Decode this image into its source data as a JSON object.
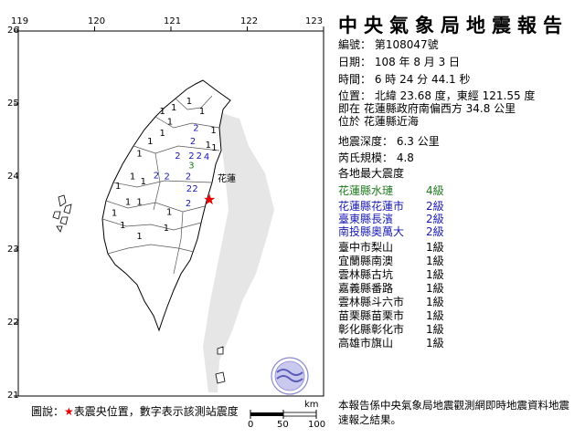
{
  "report": {
    "title": "中央氣象局地震報告",
    "number": "編號： 第108047號",
    "date": "日期： 108 年 8 月 3 日",
    "time": "時間： 6 時 24 分 44.1 秒",
    "position": "位置： 北緯 23.68 度，東經 121.55 度",
    "relative_location": "即在 花蓮縣政府南偏西方 34.8 公里",
    "located_in": "位於 花蓮縣近海",
    "depth": "地震深度： 6.3 公里",
    "magnitude": "芮氏規模： 4.8",
    "intensity_heading": "各地最大震度",
    "intensities": [
      {
        "station": "花蓮縣水璉",
        "level": "4級",
        "color": "#1f7a1f"
      },
      {
        "station": "花蓮縣花蓮市",
        "level": "2級",
        "color": "#1a1ab5"
      },
      {
        "station": "臺東縣長濱",
        "level": "2級",
        "color": "#1a1ab5"
      },
      {
        "station": "南投縣奧萬大",
        "level": "2級",
        "color": "#1a1ab5"
      },
      {
        "station": "臺中市梨山",
        "level": "1級",
        "color": "#000000"
      },
      {
        "station": "宜蘭縣南澳",
        "level": "1級",
        "color": "#000000"
      },
      {
        "station": "雲林縣古坑",
        "level": "1級",
        "color": "#000000"
      },
      {
        "station": "嘉義縣番路",
        "level": "1級",
        "color": "#000000"
      },
      {
        "station": "雲林縣斗六市",
        "level": "1級",
        "color": "#000000"
      },
      {
        "station": "苗栗縣苗栗市",
        "level": "1級",
        "color": "#000000"
      },
      {
        "station": "彰化縣彰化市",
        "level": "1級",
        "color": "#000000"
      },
      {
        "station": "高雄市旗山",
        "level": "1級",
        "color": "#000000"
      }
    ],
    "footnote": "本報告係中央氣象局地震觀測網即時地震資料地震速報之結果。"
  },
  "map": {
    "x_ticks": [
      "119",
      "120",
      "121",
      "122",
      "123"
    ],
    "y_ticks": [
      "26",
      "25",
      "24",
      "23",
      "22",
      "21"
    ],
    "label_hualien": "花蓮",
    "epicenter_color": "#e60000",
    "legend": {
      "prefix": "圖說：",
      "star": "★",
      "suffix": "表震央位置，數字表示該測站震度"
    },
    "scale": {
      "unit": "km",
      "ticks": [
        "0",
        "50",
        "100"
      ]
    },
    "station_markers": [
      {
        "value": "2",
        "color": "#1a1ab5",
        "lon": 121.25,
        "lat": 24.45
      },
      {
        "value": "2",
        "color": "#1a1ab5",
        "lon": 121.05,
        "lat": 24.25
      },
      {
        "value": "2",
        "color": "#1a1ab5",
        "lon": 121.23,
        "lat": 24.25
      },
      {
        "value": "2",
        "color": "#1a1ab5",
        "lon": 121.33,
        "lat": 24.25
      },
      {
        "value": "4",
        "color": "#1a1ab5",
        "lon": 121.43,
        "lat": 24.24
      },
      {
        "value": "3",
        "color": "#1f7a1f",
        "lon": 121.23,
        "lat": 24.12
      },
      {
        "value": "2",
        "color": "#1a1ab5",
        "lon": 120.77,
        "lat": 23.98
      },
      {
        "value": "2",
        "color": "#1a1ab5",
        "lon": 121.19,
        "lat": 23.97
      },
      {
        "value": "2",
        "color": "#1a1ab5",
        "lon": 121.2,
        "lat": 23.8
      },
      {
        "value": "2",
        "color": "#1a1ab5",
        "lon": 121.28,
        "lat": 23.8
      },
      {
        "value": "2",
        "color": "#1a1ab5",
        "lon": 120.91,
        "lat": 23.97
      },
      {
        "value": "2",
        "color": "#1a1ab5",
        "lon": 121.19,
        "lat": 23.6
      },
      {
        "value": "2",
        "color": "#1a1ab5",
        "lon": 121.29,
        "lat": 24.63
      },
      {
        "value": "1",
        "color": "#000000",
        "lon": 121.52,
        "lat": 24.6
      },
      {
        "value": "1",
        "color": "#000000",
        "lon": 121.53,
        "lat": 24.36
      },
      {
        "value": "1",
        "color": "#000000",
        "lon": 121.45,
        "lat": 24.4
      },
      {
        "value": "1",
        "color": "#000000",
        "lon": 120.85,
        "lat": 24.86
      },
      {
        "value": "1",
        "color": "#000000",
        "lon": 121.0,
        "lat": 24.91
      },
      {
        "value": "1",
        "color": "#000000",
        "lon": 121.2,
        "lat": 25.0
      },
      {
        "value": "1",
        "color": "#000000",
        "lon": 121.37,
        "lat": 24.86
      },
      {
        "value": "1",
        "color": "#000000",
        "lon": 120.95,
        "lat": 24.72
      },
      {
        "value": "1",
        "color": "#000000",
        "lon": 120.85,
        "lat": 24.56
      },
      {
        "value": "1",
        "color": "#000000",
        "lon": 120.69,
        "lat": 24.45
      },
      {
        "value": "1",
        "color": "#000000",
        "lon": 120.55,
        "lat": 24.28
      },
      {
        "value": "1",
        "color": "#000000",
        "lon": 120.46,
        "lat": 23.97
      },
      {
        "value": "1",
        "color": "#000000",
        "lon": 120.6,
        "lat": 23.9
      },
      {
        "value": "1",
        "color": "#000000",
        "lon": 120.27,
        "lat": 23.84
      },
      {
        "value": "1",
        "color": "#000000",
        "lon": 120.4,
        "lat": 23.62
      },
      {
        "value": "1",
        "color": "#000000",
        "lon": 120.55,
        "lat": 23.62
      },
      {
        "value": "1",
        "color": "#000000",
        "lon": 120.22,
        "lat": 23.47
      },
      {
        "value": "1",
        "color": "#000000",
        "lon": 120.55,
        "lat": 23.15
      },
      {
        "value": "1",
        "color": "#000000",
        "lon": 120.33,
        "lat": 23.3
      },
      {
        "value": "1",
        "color": "#000000",
        "lon": 120.9,
        "lat": 23.26
      },
      {
        "value": "1",
        "color": "#000000",
        "lon": 120.94,
        "lat": 23.48
      }
    ]
  }
}
